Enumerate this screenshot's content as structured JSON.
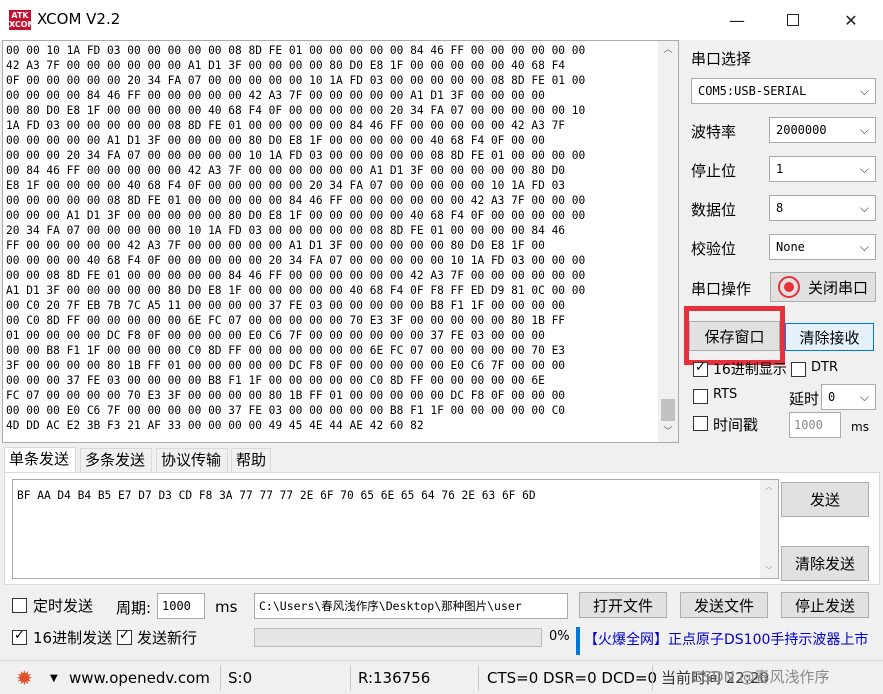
{
  "window": {
    "logo_text": "ATK XCOM",
    "title": "XCOM V2.2",
    "minimize": "—",
    "maximize": "",
    "close": "✕"
  },
  "receive": {
    "lines": [
      "00 00 10 1A FD 03 00 00 00 00 00 08 8D FE 01 00 00 00 00 00 84 46 FF 00 00 00 00 00 00",
      "42 A3 7F 00 00 00 00 00 00 A1 D1 3F 00 00 00 00 80 D0 E8 1F 00 00 00 00 00 40 68 F4",
      "0F 00 00 00 00 00 20 34 FA 07 00 00 00 00 00 10 1A FD 03 00 00 00 00 00 08 8D FE 01 00",
      "00 00 00 00 84 46 FF 00 00 00 00 00 42 A3 7F 00 00 00 00 00 A1 D1 3F 00 00 00 00",
      "00 80 D0 E8 1F 00 00 00 00 00 40 68 F4 0F 00 00 00 00 00 20 34 FA 07 00 00 00 00 00 10",
      "1A FD 03 00 00 00 00 00 08 8D FE 01 00 00 00 00 00 84 46 FF 00 00 00 00 00 42 A3 7F",
      "00 00 00 00 00 A1 D1 3F 00 00 00 00 80 D0 E8 1F 00 00 00 00 00 40 68 F4 0F 00 00",
      "00 00 00 20 34 FA 07 00 00 00 00 00 10 1A FD 03 00 00 00 00 00 08 8D FE 01 00 00 00 00",
      "00 84 46 FF 00 00 00 00 00 42 A3 7F 00 00 00 00 00 00 A1 D1 3F 00 00 00 00 00 80 D0",
      "E8 1F 00 00 00 00 40 68 F4 0F 00 00 00 00 00 20 34 FA 07 00 00 00 00 00 10 1A FD 03",
      "00 00 00 00 00 08 8D FE 01 00 00 00 00 00 84 46 FF 00 00 00 00 00 00 42 A3 7F 00 00 00",
      "00 00 00 A1 D1 3F 00 00 00 00 00 80 D0 E8 1F 00 00 00 00 00 40 68 F4 0F 00 00 00 00 00",
      "20 34 FA 07 00 00 00 00 00 10 1A FD 03 00 00 00 00 00 08 8D FE 01 00 00 00 00 84 46",
      "FF 00 00 00 00 00 42 A3 7F 00 00 00 00 00 A1 D1 3F 00 00 00 00 00 80 D0 E8 1F 00",
      "00 00 00 00 40 68 F4 0F 00 00 00 00 00 20 34 FA 07 00 00 00 00 00 10 1A FD 03 00 00 00",
      "00 00 08 8D FE 01 00 00 00 00 00 84 46 FF 00 00 00 00 00 00 42 A3 7F 00 00 00 00 00 00",
      "A1 D1 3F 00 00 00 00 00 80 D0 E8 1F 00 00 00 00 00 40 68 F4 0F F8 FF ED D9 81 0C 00 00",
      "00 C0 20 7F EB 7B 7C A5 11 00 00 00 00 37 FE 03 00 00 00 00 00 B8 F1 1F 00 00 00 00",
      "00 C0 8D FF 00 00 00 00 00 6E FC 07 00 00 00 00 00 70 E3 3F 00 00 00 00 00 80 1B FF",
      "01 00 00 00 00 DC F8 0F 00 00 00 00 E0 C6 7F 00 00 00 00 00 00 37 FE 03 00 00 00",
      "00 00 B8 F1 1F 00 00 00 00 C0 8D FF 00 00 00 00 00 00 6E FC 07 00 00 00 00 00 70 E3",
      "3F 00 00 00 00 80 1B FF 01 00 00 00 00 00 DC F8 0F 00 00 00 00 00 E0 C6 7F 00 00 00",
      "00 00 00 37 FE 03 00 00 00 00 B8 F1 1F 00 00 00 00 00 C0 8D FF 00 00 00 00 00 6E",
      "FC 07 00 00 00 00 70 E3 3F 00 00 00 00 80 1B FF 01 00 00 00 00 00 DC F8 0F 00 00 00",
      "00 00 00 E0 C6 7F 00 00 00 00 00 37 FE 03 00 00 00 00 00 B8 F1 1F 00 00 00 00 00 C0",
      "4D DD AC E2 3B F3 21 AF 33 00 00 00 00 49 45 4E 44 AE 42 60 82"
    ]
  },
  "settings": {
    "port_label": "串口选择",
    "port_value": "COM5:USB-SERIAL",
    "baud_label": "波特率",
    "baud_value": "2000000",
    "stop_label": "停止位",
    "stop_value": "1",
    "data_label": "数据位",
    "data_value": "8",
    "parity_label": "校验位",
    "parity_value": "None",
    "op_label": "串口操作",
    "close_port": "关闭串口",
    "save_window": "保存窗口",
    "clear_recv": "清除接收",
    "hex_display": "16进制显示",
    "dtr": "DTR",
    "rts": "RTS",
    "delay_label": "延时",
    "delay_value": "0",
    "timestamp": "时间戳",
    "timestamp_value": "1000",
    "timestamp_unit": "ms",
    "chevron": "⌵"
  },
  "tabs": [
    "单条发送",
    "多条发送",
    "协议传输",
    "帮助"
  ],
  "send": {
    "text": "BF AA D4 B4 B5 E7 D7 D3 CD F8 3A 77 77 77 2E 6F 70 65 6E 65 64 76 2E 63 6F 6D",
    "send_button": "发送",
    "clear_send": "清除发送",
    "timed_send": "定时发送",
    "period_label": "周期:",
    "period_value": "1000",
    "period_unit": "ms",
    "file_path": "C:\\Users\\春风浅作序\\Desktop\\那种图片\\user",
    "open_file": "打开文件",
    "send_file": "发送文件",
    "stop_send": "停止发送",
    "hex_send": "16进制发送",
    "send_newline": "发送新行",
    "progress_pct": "0%",
    "progress_value": 0,
    "ad_text": "【火爆全网】正点原子DS100手持示波器上市"
  },
  "status": {
    "site": "www.openedv.com",
    "s_count": "S:0",
    "r_count": "R:136756",
    "lines": "CTS=0 DSR=0 DCD=0",
    "time": "当前时间 22:20",
    "watermark": "CSDN @春风浅作序"
  }
}
